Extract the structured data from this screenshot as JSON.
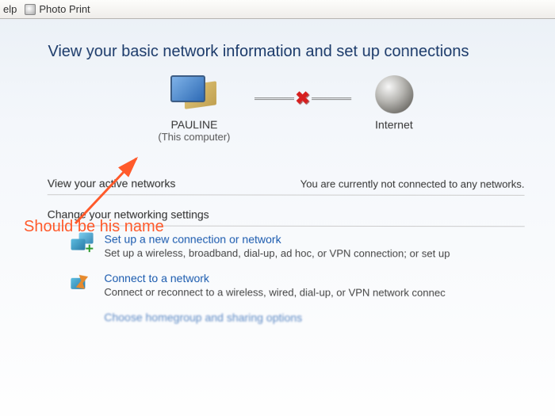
{
  "menubar": {
    "help_fragment": "elp",
    "photo_print": "Photo Print"
  },
  "heading": "View your basic network information and set up connections",
  "map": {
    "computer": {
      "name": "PAULINE",
      "subtitle": "(This computer)"
    },
    "internet": {
      "name": "Internet"
    }
  },
  "active_networks": {
    "label": "View your active networks",
    "status": "You are currently not connected to any networks."
  },
  "settings_header": "Change your networking settings",
  "settings": [
    {
      "title": "Set up a new connection or network",
      "desc": "Set up a wireless, broadband, dial-up, ad hoc, or VPN connection; or set up"
    },
    {
      "title": "Connect to a network",
      "desc": "Connect or reconnect to a wireless, wired, dial-up, or VPN network connec"
    }
  ],
  "cutoff_item_title": "Choose homegroup and sharing options",
  "annotation": "Should be his name"
}
